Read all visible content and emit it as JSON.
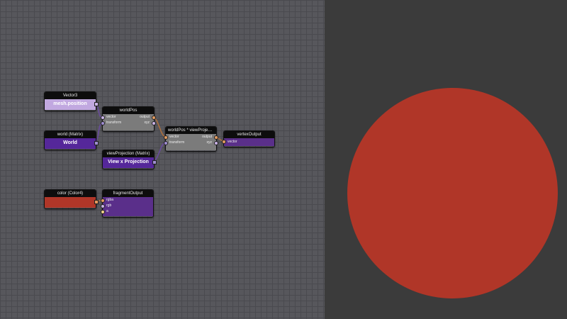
{
  "colors": {
    "vec_port": "#c9b2e6",
    "vec4_port": "#e29a5f",
    "mat_port": "#9e8cd0",
    "float_port": "#f2d28a",
    "link": "#6a4aa0",
    "sphere": "#b03628"
  },
  "nodes": {
    "vec3": {
      "title": "Vector3",
      "value": "mesh.position"
    },
    "world": {
      "title": "world (Matrix)",
      "value": "World"
    },
    "viewproj": {
      "title": "viewProjection (Matrix)",
      "value": "View x Projection"
    },
    "color": {
      "title": "color (Color4)"
    },
    "worldpos": {
      "title": "worldPos",
      "in1": "vector",
      "in2": "transform",
      "out1": "output",
      "out2": "xyz"
    },
    "wvp": {
      "title": "worldPos * viewProjectio...",
      "in1": "vector",
      "in2": "transform",
      "out1": "output",
      "out2": "xyz"
    },
    "vertex": {
      "title": "vertexOutput",
      "in1": "vector"
    },
    "fragment": {
      "title": "fragmentOutput",
      "in1": "rgba",
      "in2": "rgb",
      "in3": "a"
    }
  }
}
